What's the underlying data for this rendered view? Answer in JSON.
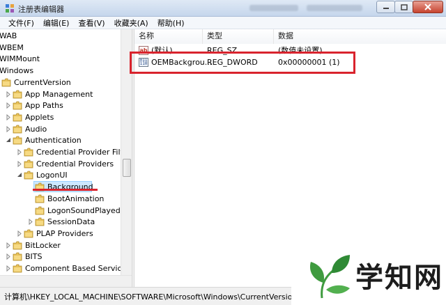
{
  "window": {
    "title": "注册表编辑器",
    "buttons": {
      "minimize": "minimize",
      "maximize": "maximize",
      "close": "close"
    }
  },
  "menu": [
    "文件(F)",
    "编辑(E)",
    "查看(V)",
    "收藏夹(A)",
    "帮助(H)"
  ],
  "tree": {
    "items": [
      {
        "label": "WAB",
        "level": 0,
        "arrow": "none",
        "folder": false
      },
      {
        "label": "WBEM",
        "level": 0,
        "arrow": "none",
        "folder": false
      },
      {
        "label": "WIMMount",
        "level": 0,
        "arrow": "none",
        "folder": false
      },
      {
        "label": "Windows",
        "level": 0,
        "arrow": "none",
        "folder": false
      },
      {
        "label": "CurrentVersion",
        "level": 0,
        "arrow": "none",
        "folder": false
      },
      {
        "label": "App Management",
        "level": 1,
        "arrow": "collapsed",
        "folder": true
      },
      {
        "label": "App Paths",
        "level": 1,
        "arrow": "collapsed",
        "folder": true
      },
      {
        "label": "Applets",
        "level": 1,
        "arrow": "collapsed",
        "folder": true
      },
      {
        "label": "Audio",
        "level": 1,
        "arrow": "collapsed",
        "folder": true
      },
      {
        "label": "Authentication",
        "level": 1,
        "arrow": "expanded",
        "folder": true
      },
      {
        "label": "Credential Provider Filters",
        "level": 2,
        "arrow": "collapsed",
        "folder": true
      },
      {
        "label": "Credential Providers",
        "level": 2,
        "arrow": "collapsed",
        "folder": true
      },
      {
        "label": "LogonUI",
        "level": 2,
        "arrow": "expanded",
        "folder": true
      },
      {
        "label": "Background",
        "level": 3,
        "arrow": "none",
        "folder": true,
        "selected": true
      },
      {
        "label": "BootAnimation",
        "level": 3,
        "arrow": "none",
        "folder": true
      },
      {
        "label": "LogonSoundPlayed",
        "level": 3,
        "arrow": "none",
        "folder": true
      },
      {
        "label": "SessionData",
        "level": 3,
        "arrow": "collapsed",
        "folder": true
      },
      {
        "label": "PLAP Providers",
        "level": 2,
        "arrow": "collapsed",
        "folder": true
      },
      {
        "label": "BitLocker",
        "level": 1,
        "arrow": "collapsed",
        "folder": true
      },
      {
        "label": "BITS",
        "level": 1,
        "arrow": "collapsed",
        "folder": true
      },
      {
        "label": "Component Based Servicing",
        "level": 1,
        "arrow": "collapsed",
        "folder": true
      }
    ]
  },
  "list": {
    "columns": [
      "名称",
      "类型",
      "数据"
    ],
    "rows": [
      {
        "name": "(默认)",
        "type": "REG_SZ",
        "data": "(数值未设置)",
        "icon": "string-value-icon"
      },
      {
        "name": "OEMBackgrou...",
        "type": "REG_DWORD",
        "data": "0x00000001 (1)",
        "icon": "dword-value-icon"
      }
    ]
  },
  "statusbar": {
    "path": "计算机\\HKEY_LOCAL_MACHINE\\SOFTWARE\\Microsoft\\Windows\\CurrentVersion\\Authe"
  },
  "watermark": {
    "text": "学知网"
  },
  "colors": {
    "highlight": "#d9232d",
    "selection": "#cde8ff",
    "folder": "#e8c25a"
  }
}
